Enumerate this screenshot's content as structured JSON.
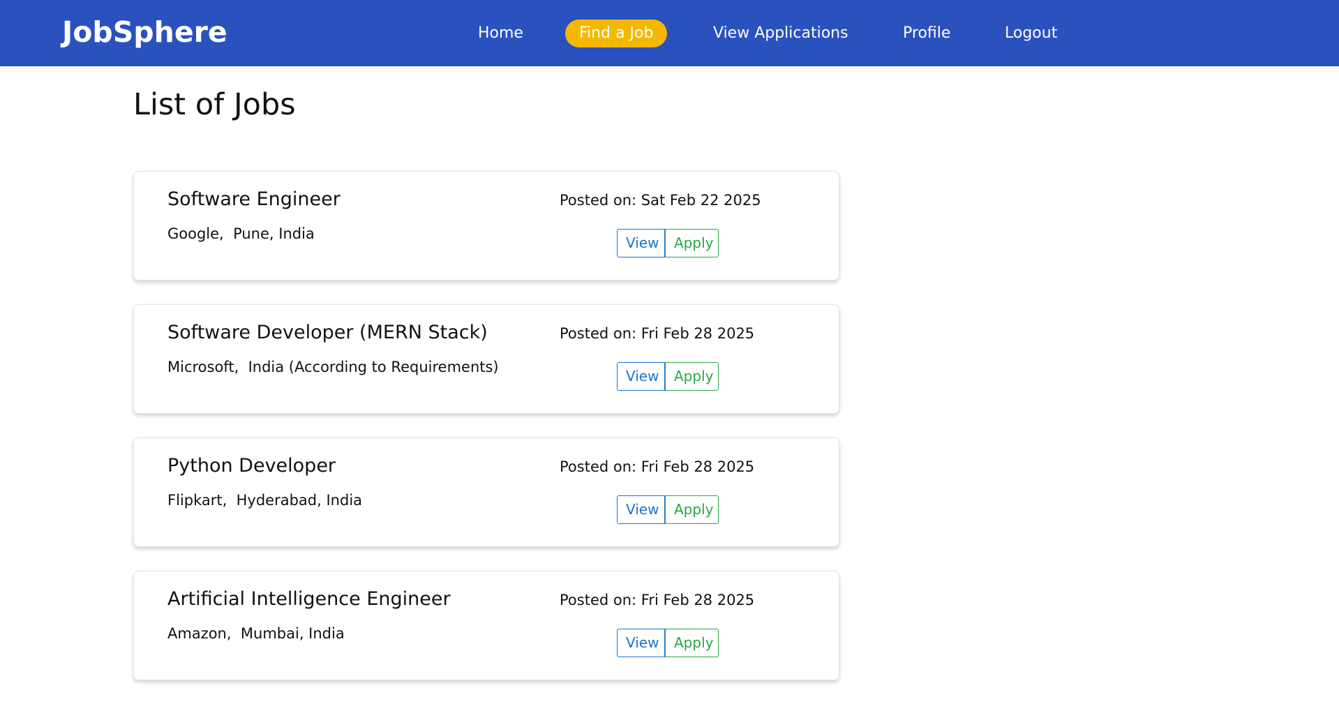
{
  "header": {
    "brand": "JobSphere",
    "nav": [
      {
        "label": "Home",
        "active": false
      },
      {
        "label": "Find a Job",
        "active": true
      },
      {
        "label": "View Applications",
        "active": false
      },
      {
        "label": "Profile",
        "active": false
      },
      {
        "label": "Logout",
        "active": false
      }
    ]
  },
  "main": {
    "title": "List of Jobs",
    "jobs": [
      {
        "title": "Software Engineer",
        "meta": "Google,  Pune, India",
        "posted": "Posted on: Sat Feb 22 2025",
        "view_label": "View",
        "apply_label": "Apply"
      },
      {
        "title": "Software Developer (MERN Stack)",
        "meta": "Microsoft,  India (According to Requirements)",
        "posted": "Posted on: Fri Feb 28 2025",
        "view_label": "View",
        "apply_label": "Apply"
      },
      {
        "title": "Python Developer",
        "meta": "Flipkart,  Hyderabad, India",
        "posted": "Posted on: Fri Feb 28 2025",
        "view_label": "View",
        "apply_label": "Apply"
      },
      {
        "title": "Artificial Intelligence Engineer",
        "meta": "Amazon,  Mumbai, India",
        "posted": "Posted on: Fri Feb 28 2025",
        "view_label": "View",
        "apply_label": "Apply"
      }
    ]
  },
  "colors": {
    "navbar": "#2a52be",
    "active_pill": "#f5b800",
    "view_button": "#1a73d4",
    "apply_button": "#28a745"
  }
}
